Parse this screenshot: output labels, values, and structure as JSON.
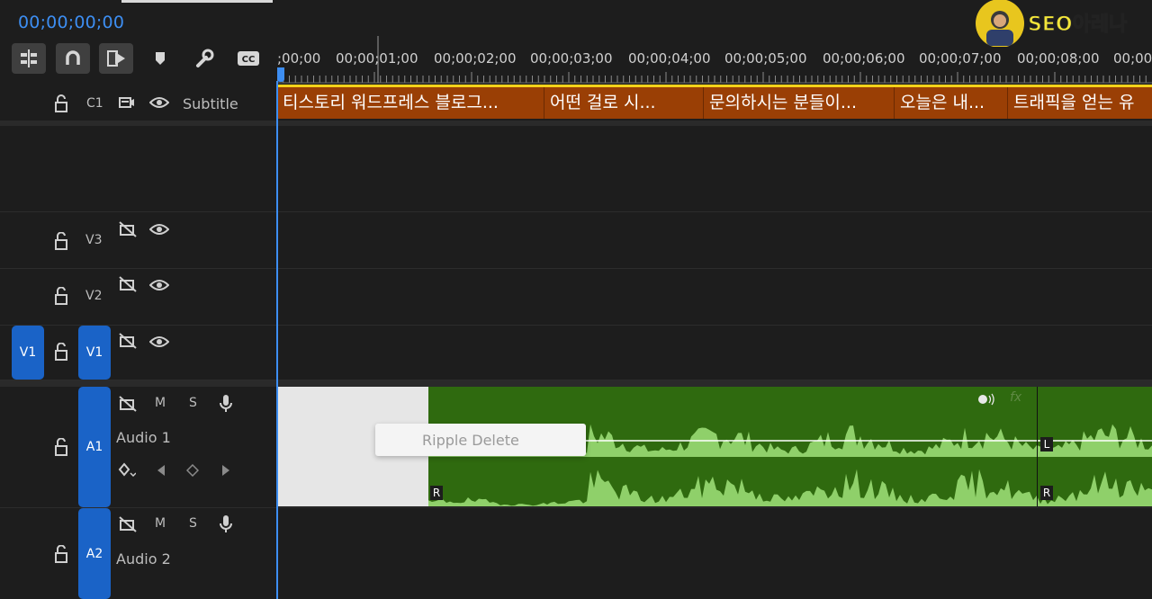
{
  "timecode": "00;00;00;00",
  "logo_text": "SEO아레나",
  "toolbar": [
    {
      "name": "insert-nest-button",
      "active": true
    },
    {
      "name": "snap-button",
      "active": true
    },
    {
      "name": "linked-selection-button",
      "active": true
    },
    {
      "name": "add-marker-button",
      "active": false
    },
    {
      "name": "timeline-settings-button",
      "active": false
    },
    {
      "name": "captions-button",
      "active": false,
      "label": "CC"
    }
  ],
  "ruler": {
    "timecodes": [
      ";00;00",
      "00;00;01;00",
      "00;00;02;00",
      "00;00;03;00",
      "00;00;04;00",
      "00;00;05;00",
      "00;00;06;00",
      "00;00;07;00",
      "00;00;08;00",
      "00;00"
    ]
  },
  "tracks": {
    "c1": {
      "id": "C1",
      "name": "Subtitle"
    },
    "v3": {
      "id": "V3"
    },
    "v2": {
      "id": "V2"
    },
    "v1": {
      "id": "V1",
      "source_patch": "V1"
    },
    "a1": {
      "id": "A1",
      "name": "Audio 1",
      "mute": "M",
      "solo": "S"
    },
    "a2": {
      "id": "A2",
      "name": "Audio 2",
      "mute": "M",
      "solo": "S"
    }
  },
  "subtitle_clips": [
    "티스토리 워드프레스 블로그...",
    "어떤 걸로 시...",
    "문의하시는 분들이...",
    "오늘은 내...",
    "트래픽을 얻는 유"
  ],
  "context_menu": {
    "item": "Ripple Delete"
  },
  "audio_clip": {
    "channel_top": "L",
    "channel_bottom": "R",
    "fx": "fx"
  },
  "colors": {
    "accent": "#3d8ef2",
    "subtitle_clip": "#9a3f05",
    "audio_clip": "#2f6a0f",
    "waveform": "#8fd06a",
    "track_target": "#1a63c7"
  }
}
